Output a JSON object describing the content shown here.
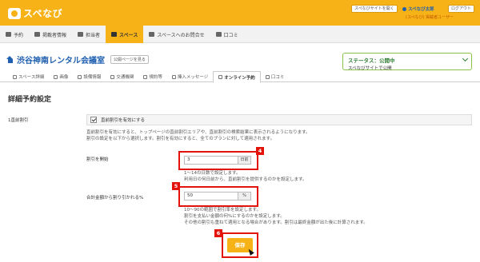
{
  "header": {
    "logo_text": "スペなび",
    "site_button": "スペなびサイトを開く",
    "user_name": "スペなび太郎",
    "logout_button": "ログアウト",
    "role": "(スペなび) 掲載者ユーザー"
  },
  "main_nav": [
    {
      "label": "予約",
      "icon": "calendar-icon"
    },
    {
      "label": "掲載者情報",
      "icon": "briefcase-icon"
    },
    {
      "label": "担当者",
      "icon": "user-icon"
    },
    {
      "label": "スペース",
      "icon": "home-icon"
    },
    {
      "label": "スペースへのお問合せ",
      "icon": "chat-icon"
    },
    {
      "label": "口コミ",
      "icon": "review-icon"
    }
  ],
  "page": {
    "title": "渋谷神南レンタル会議室",
    "public_link": "公開ページを見る",
    "status_label": "ステータス：公開中",
    "status_sub": "スペなびサイトで公開"
  },
  "sub_tabs": [
    {
      "label": "スペース詳細"
    },
    {
      "label": "画像"
    },
    {
      "label": "設備情報"
    },
    {
      "label": "交通機関"
    },
    {
      "label": "規約等"
    },
    {
      "label": "挿入メッセージ"
    },
    {
      "label": "オンライン予約"
    },
    {
      "label": "口コミ"
    }
  ],
  "section": {
    "title": "詳細予約設定",
    "field_label": "1直前割引",
    "checkbox_label": "直前割引を有効にする",
    "desc1_line1": "直前割引を有効にすると、トップページの直前割引エリアや、直前割引の検索結果に表示されるようになります。",
    "desc1_line2": "割引の設定を以下から選択します。割引を有効にすると、全てのプランに対して適用されます。",
    "discount_start_label": "割引を開始",
    "discount_start_value": "3",
    "discount_start_unit": "日前",
    "desc2_line1": "1〜14の日数で設定します。",
    "desc2_line2": "利用日の何日前から、直前割引を提供するのかを設定します。",
    "discount_rate_label": "合計金額から割り引かれる%",
    "discount_rate_value": "50",
    "discount_rate_unit": "%",
    "desc3_line1": "10〜90の範囲で割引率を設定します。",
    "desc3_line2": "割引を支払い金額の何%にするのかを設定します。",
    "desc3_line3": "その他の割引も重ねて適用となる場合があります。割引は最終金額が出た後に計算されます。",
    "save_button": "保存"
  },
  "annotations": [
    "4",
    "5",
    "6"
  ],
  "colors": {
    "accent": "#f7b218",
    "link": "#2060b0",
    "highlight": "#e3120b",
    "status": "#2e7d32"
  }
}
